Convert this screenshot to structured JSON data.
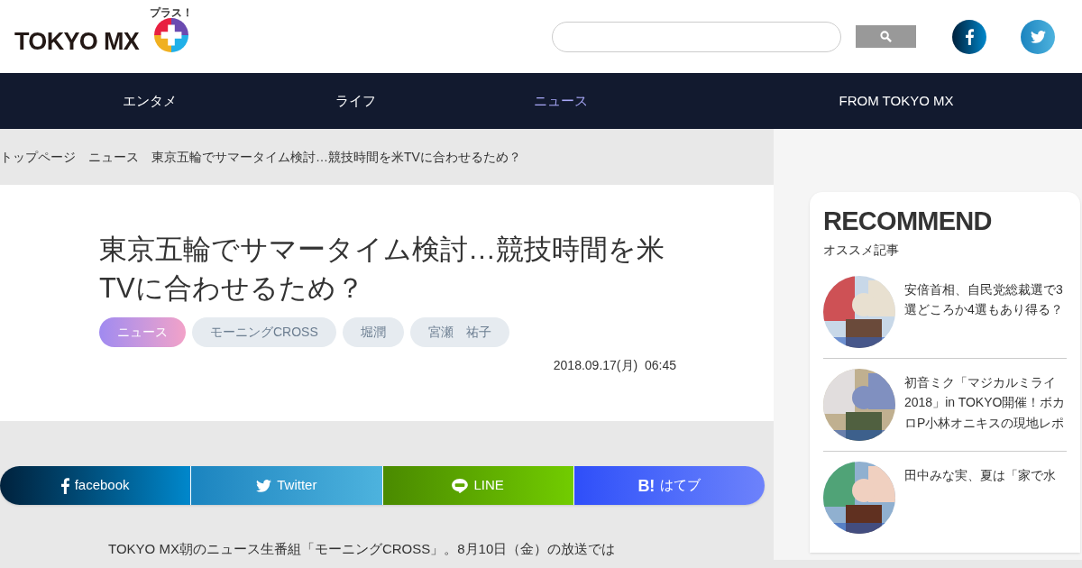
{
  "logo": {
    "text": "TOKYO MX",
    "badge": "プラス！"
  },
  "nav": [
    {
      "label": "エンタメ",
      "selected": false
    },
    {
      "label": "ライフ",
      "selected": false
    },
    {
      "label": "ニュース",
      "selected": true
    },
    {
      "label": "FROM TOKYO MX",
      "selected": false
    }
  ],
  "breadcrumb": [
    "トップページ",
    "ニュース",
    "東京五輪でサマータイム検討…競技時間を米TVに合わせるため？"
  ],
  "article": {
    "title": "東京五輪でサマータイム検討…競技時間を米TVに合わせるため？",
    "tags": [
      {
        "label": "ニュース",
        "selected": true
      },
      {
        "label": "モーニングCROSS",
        "selected": false
      },
      {
        "label": "堀潤",
        "selected": false
      },
      {
        "label": "宮瀬　祐子",
        "selected": false
      }
    ],
    "date": "2018.09.17(月)  06:45",
    "share": [
      {
        "kind": "facebook",
        "label": "facebook"
      },
      {
        "kind": "twitter",
        "label": "Twitter"
      },
      {
        "kind": "line",
        "label": "LINE"
      },
      {
        "kind": "hatena",
        "label": "はてブ",
        "icon_text": "B!"
      }
    ],
    "body": "TOKYO MX朝のニュース生番組「モーニングCROSS」。8月10日（金）の放送では"
  },
  "recommend": {
    "title": "RECOMMEND",
    "subtitle": "オススメ記事",
    "items": [
      {
        "title": "安倍首相、自民党総裁選で3選どころか4選もあり得る？",
        "kind": "picture"
      },
      {
        "title": "初音ミク「マジカルミライ2018」in TOKYO開催！ボカロP小林オニキスの現地レポ",
        "kind": "picture"
      },
      {
        "title": "田中みな実、夏は「家で水",
        "kind": "picture"
      }
    ]
  }
}
